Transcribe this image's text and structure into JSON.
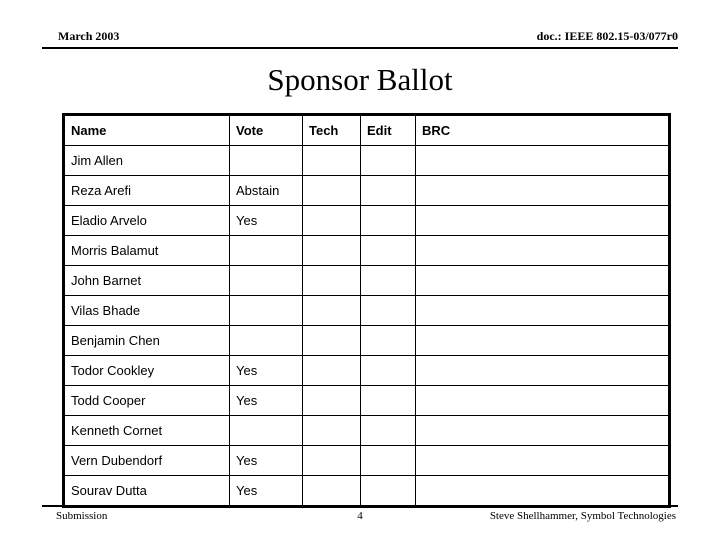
{
  "header": {
    "left": "March 2003",
    "right": "doc.: IEEE 802.15-03/077r0"
  },
  "title": "Sponsor Ballot",
  "table": {
    "columns": [
      "Name",
      "Vote",
      "Tech",
      "Edit",
      "BRC"
    ],
    "rows": [
      {
        "name": "Jim Allen",
        "vote": "",
        "tech": "",
        "edit": "",
        "brc": ""
      },
      {
        "name": "Reza Arefi",
        "vote": "Abstain",
        "tech": "",
        "edit": "",
        "brc": ""
      },
      {
        "name": "Eladio Arvelo",
        "vote": "Yes",
        "tech": "",
        "edit": "",
        "brc": ""
      },
      {
        "name": "Morris Balamut",
        "vote": "",
        "tech": "",
        "edit": "",
        "brc": ""
      },
      {
        "name": "John Barnet",
        "vote": "",
        "tech": "",
        "edit": "",
        "brc": ""
      },
      {
        "name": "Vilas Bhade",
        "vote": "",
        "tech": "",
        "edit": "",
        "brc": ""
      },
      {
        "name": "Benjamin Chen",
        "vote": "",
        "tech": "",
        "edit": "",
        "brc": ""
      },
      {
        "name": "Todor Cookley",
        "vote": "Yes",
        "tech": "",
        "edit": "",
        "brc": ""
      },
      {
        "name": "Todd Cooper",
        "vote": "Yes",
        "tech": "",
        "edit": "",
        "brc": ""
      },
      {
        "name": "Kenneth Cornet",
        "vote": "",
        "tech": "",
        "edit": "",
        "brc": ""
      },
      {
        "name": "Vern Dubendorf",
        "vote": "Yes",
        "tech": "",
        "edit": "",
        "brc": ""
      },
      {
        "name": "Sourav Dutta",
        "vote": "Yes",
        "tech": "",
        "edit": "",
        "brc": ""
      }
    ]
  },
  "footer": {
    "left": "Submission",
    "page": "4",
    "right": "Steve Shellhammer, Symbol Technologies"
  }
}
